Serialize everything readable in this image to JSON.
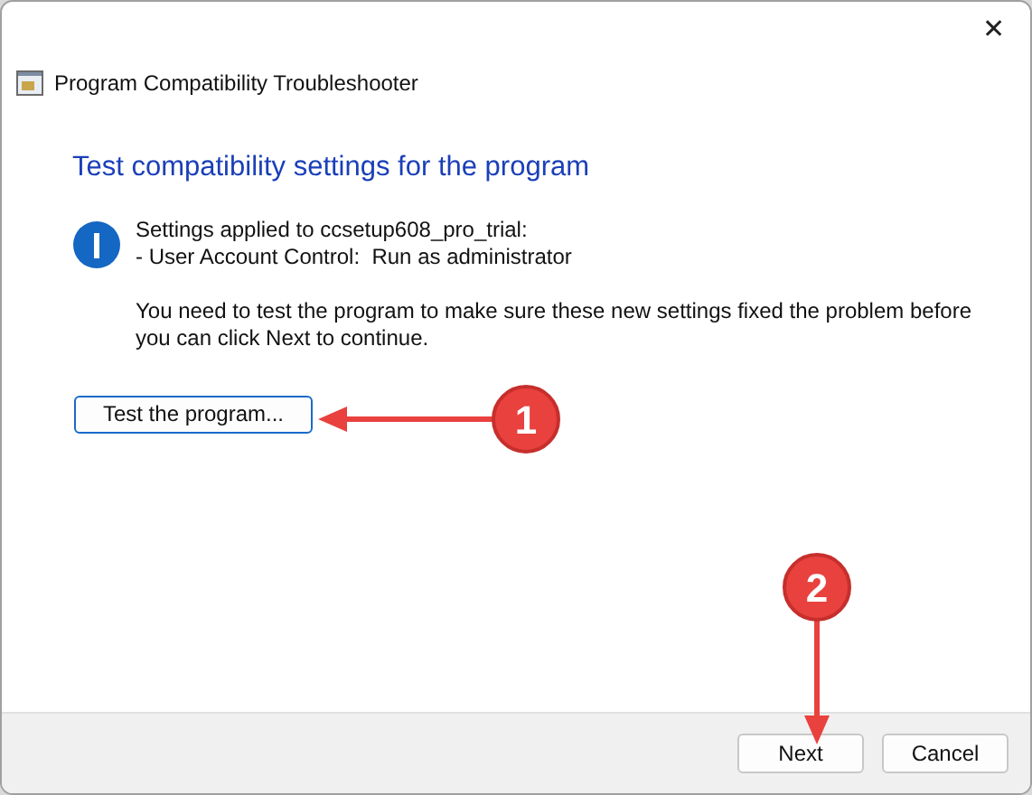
{
  "window": {
    "title": "Program Compatibility Troubleshooter",
    "close": "✕"
  },
  "heading": "Test compatibility settings for the program",
  "info": {
    "lines": [
      "Settings applied to ccsetup608_pro_trial:",
      "- User Account Control:  Run as administrator"
    ]
  },
  "message": "You need to test the program to make sure these new settings fixed the problem before you can click Next to continue.",
  "test_button": "Test the program...",
  "footer_buttons": [
    "Next",
    "Cancel"
  ],
  "annotations": [
    {
      "label": "1",
      "kind": "left"
    },
    {
      "label": "2",
      "kind": "down"
    }
  ]
}
